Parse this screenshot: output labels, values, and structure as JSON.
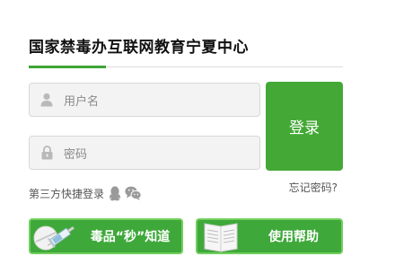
{
  "header": {
    "title": "国家禁毒办互联网教育宁夏中心"
  },
  "login_form": {
    "username_placeholder": "用户名",
    "password_placeholder": "密码",
    "login_label": "登录",
    "third_party_label": "第三方快捷登录",
    "forgot_password": "忘记密码?"
  },
  "quick_links": [
    {
      "label": "毒品“秒”知道",
      "icon": "syringe-pill-icon"
    },
    {
      "label": "使用帮助",
      "icon": "open-book-icon"
    }
  ],
  "colors": {
    "accent": "#44a836",
    "button_border": "#71cf5d",
    "field_bg": "#f3f3f3"
  }
}
